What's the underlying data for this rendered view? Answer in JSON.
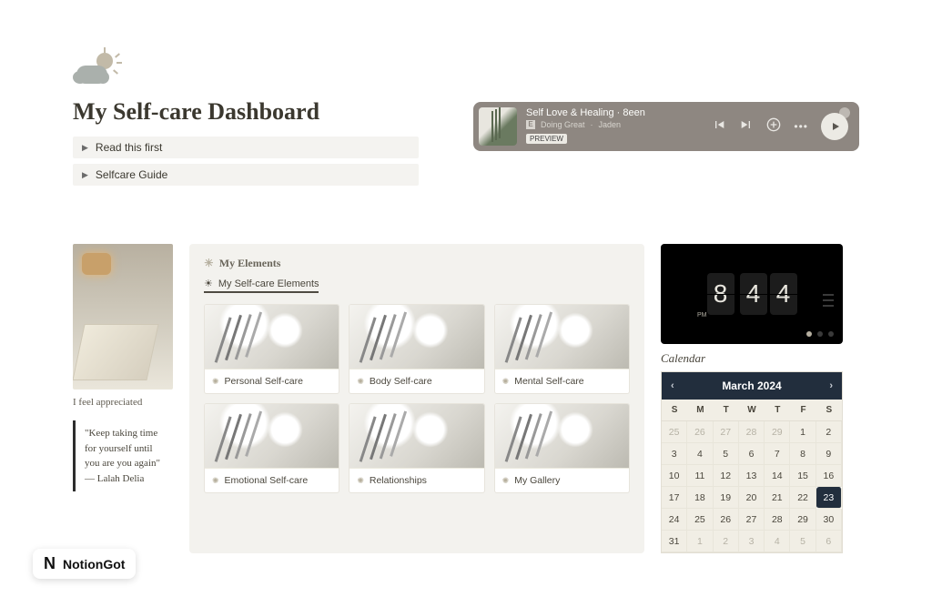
{
  "header": {
    "title": "My Self-care Dashboard",
    "toggles": [
      "Read this first",
      "Selfcare Guide"
    ]
  },
  "spotify": {
    "playlist": "Self Love & Healing · 8een",
    "track": "Doing Great",
    "artist": "Jaden",
    "preview_label": "PREVIEW"
  },
  "left": {
    "feeling": "I feel appreciated",
    "quote": "\"Keep taking time for yourself until you are you again\"       — Lalah Delia"
  },
  "elements": {
    "section_title": "My Elements",
    "tab_label": "My Self-care Elements",
    "cards": [
      "Personal Self-care",
      "Body Self-care",
      "Mental Self-care",
      "Emotional Self-care",
      "Relationships",
      "My Gallery"
    ]
  },
  "clock": {
    "hour": "8",
    "minute_tens": "4",
    "minute_ones": "4",
    "meridiem": "PM"
  },
  "calendar": {
    "title": "Calendar",
    "month": "March 2024",
    "dow": [
      "S",
      "M",
      "T",
      "W",
      "T",
      "F",
      "S"
    ],
    "leading_out": [
      "25",
      "26",
      "27",
      "28",
      "29"
    ],
    "days": [
      "1",
      "2",
      "3",
      "4",
      "5",
      "6",
      "7",
      "8",
      "9",
      "10",
      "11",
      "12",
      "13",
      "14",
      "15",
      "16",
      "17",
      "18",
      "19",
      "20",
      "21",
      "22",
      "23",
      "24",
      "25",
      "26",
      "27",
      "28",
      "29",
      "30",
      "31"
    ],
    "trailing_out": [
      "1",
      "2",
      "3",
      "4",
      "5",
      "6"
    ],
    "today": "23"
  },
  "badge": {
    "label": "NotionGot"
  }
}
